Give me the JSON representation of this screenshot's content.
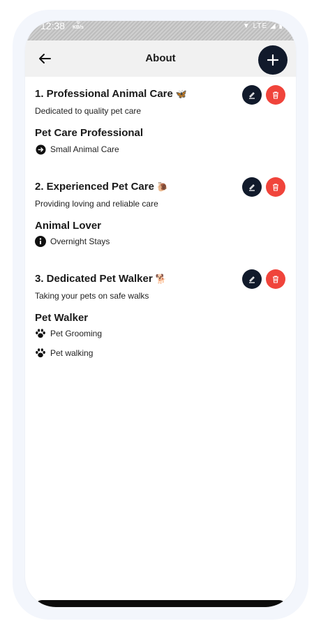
{
  "status_bar": {
    "time": "12:38",
    "speed_value": "0",
    "speed_unit": "KB/s",
    "network": "LTE"
  },
  "header": {
    "title": "About",
    "back_icon": "arrow-left-icon",
    "add_icon": "plus-icon"
  },
  "colors": {
    "dark": "#111a2b",
    "delete": "#f0443b",
    "app_bar_bg": "#f1f1f1"
  },
  "entries": [
    {
      "title": "1. Professional Animal Care",
      "emoji": "🦋",
      "subtitle": "Dedicated to quality pet care",
      "role": "Pet Care Professional",
      "skills": [
        {
          "icon": "arrow-circle-icon",
          "label": "Small Animal Care"
        }
      ]
    },
    {
      "title": "2. Experienced Pet Care",
      "emoji": "🐌",
      "subtitle": "Providing loving and reliable care",
      "role": "Animal Lover",
      "skills": [
        {
          "icon": "info-circle-icon",
          "label": "Overnight Stays"
        }
      ]
    },
    {
      "title": "3. Dedicated Pet Walker",
      "emoji": "🐕",
      "subtitle": "Taking your pets on safe walks",
      "role": "Pet Walker",
      "skills": [
        {
          "icon": "paw-icon",
          "label": "Pet Grooming"
        },
        {
          "icon": "paw-icon",
          "label": "Pet walking"
        }
      ]
    }
  ]
}
